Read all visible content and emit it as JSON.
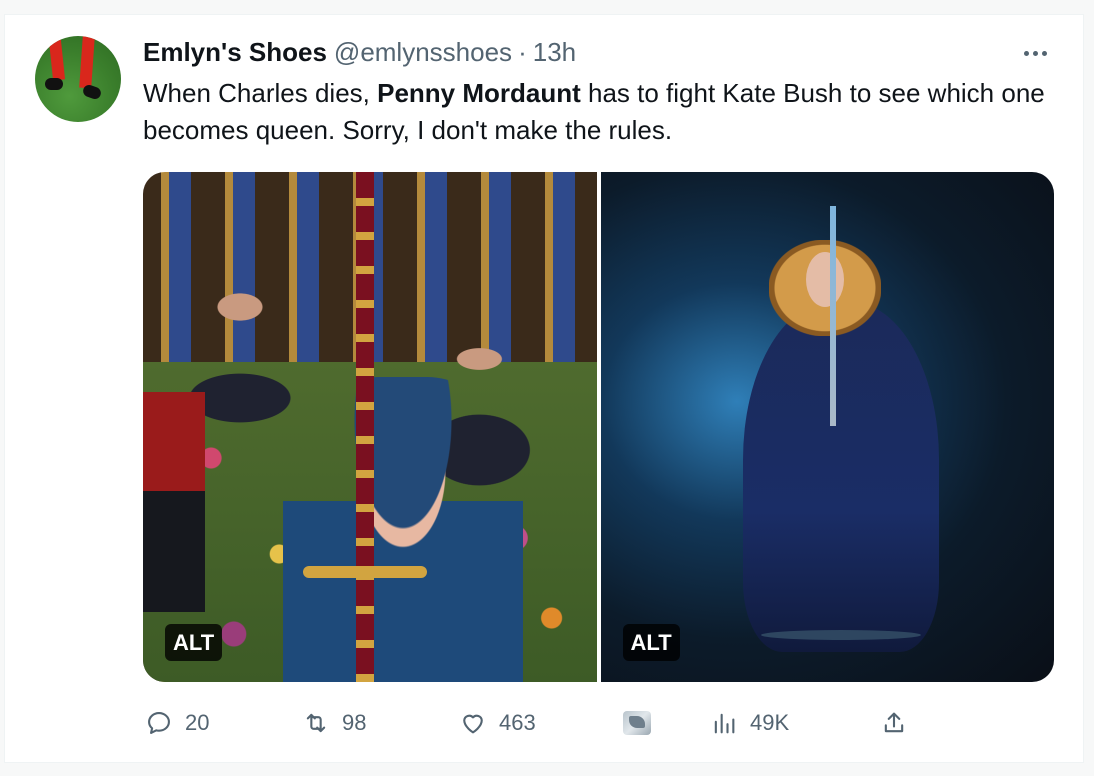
{
  "tweet": {
    "author_name": "Emlyn's Shoes",
    "handle": "@emlynsshoes",
    "separator": "·",
    "time": "13h",
    "text_part1": "When Charles dies, ",
    "text_bold": "Penny Mordaunt",
    "text_part2": " has to fight Kate Bush to see which one becomes queen. Sorry, I don't make the rules."
  },
  "media": {
    "left_alt_label": "ALT",
    "right_alt_label": "ALT"
  },
  "actions": {
    "replies": "20",
    "retweets": "98",
    "likes": "463",
    "views": "49K"
  },
  "colors": {
    "text_primary": "#0f1419",
    "text_secondary": "#536471",
    "card_border": "#eff3f4"
  }
}
